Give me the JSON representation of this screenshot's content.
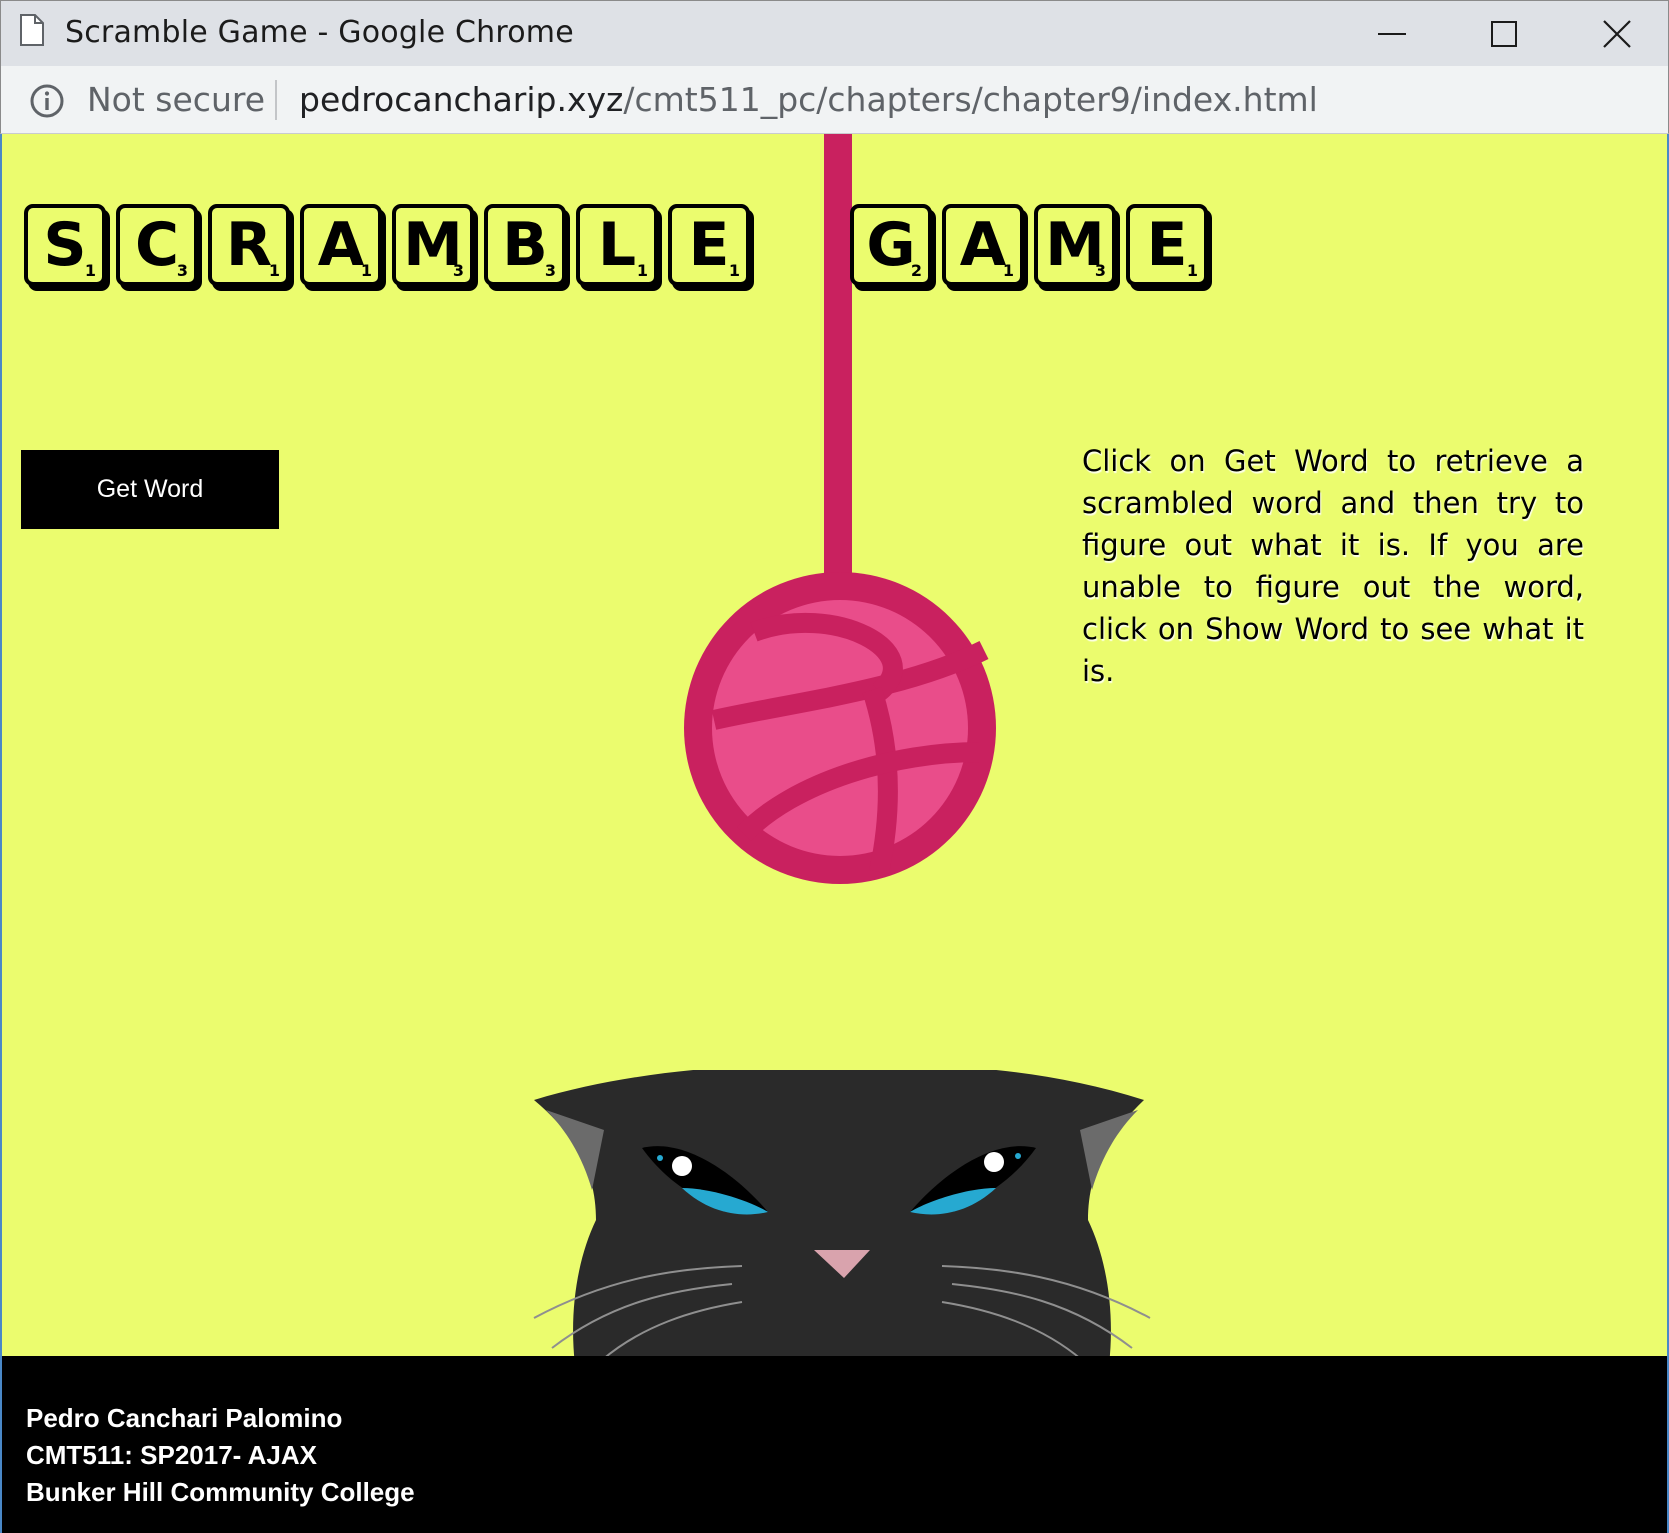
{
  "window": {
    "title": "Scramble Game - Google Chrome"
  },
  "addressbar": {
    "security_label": "Not secure",
    "url_host": "pedrocancharip.xyz",
    "url_path": "/cmt511_pc/chapters/chapter9/index.html"
  },
  "heading": {
    "word1": [
      {
        "letter": "S",
        "score": "1"
      },
      {
        "letter": "C",
        "score": "3"
      },
      {
        "letter": "R",
        "score": "1"
      },
      {
        "letter": "A",
        "score": "1"
      },
      {
        "letter": "M",
        "score": "3"
      },
      {
        "letter": "B",
        "score": "3"
      },
      {
        "letter": "L",
        "score": "1"
      },
      {
        "letter": "E",
        "score": "1"
      }
    ],
    "word2": [
      {
        "letter": "G",
        "score": "2"
      },
      {
        "letter": "A",
        "score": "1"
      },
      {
        "letter": "M",
        "score": "3"
      },
      {
        "letter": "E",
        "score": "1"
      }
    ]
  },
  "main": {
    "get_word_label": "Get Word",
    "instructions": "Click on Get Word to retrieve a scrambled word and then try to figure out what it is. If you are unable to figure out the word, click on Show Word to see what it is."
  },
  "footer": {
    "author": "Pedro Canchari Palomino",
    "course": "CMT511: SP2017- AJAX",
    "school": "Bunker Hill Community College"
  },
  "colors": {
    "page_background": "#ebfc6e",
    "yarn": "#c9215f",
    "yarn_light": "#e94d8a",
    "cat": "#2a2a2a",
    "cat_eye": "#26a9d1",
    "footer": "#000000"
  }
}
